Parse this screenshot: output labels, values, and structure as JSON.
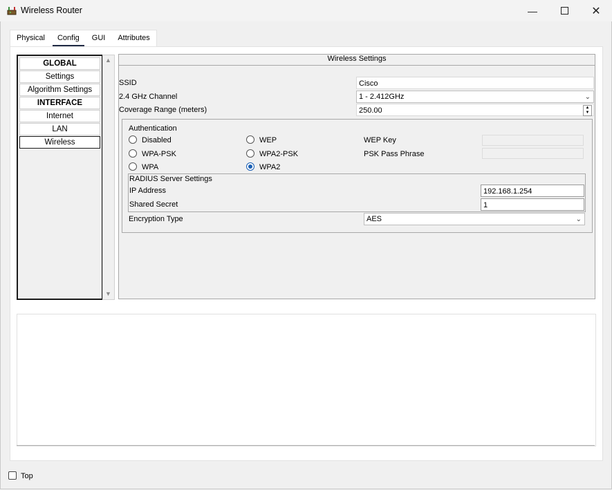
{
  "window": {
    "title": "Wireless Router",
    "icon": "router-icon",
    "controls": [
      "minimize-icon",
      "maximize-icon",
      "close-icon"
    ]
  },
  "tabs": [
    {
      "label": "Physical"
    },
    {
      "label": "Config",
      "active": true
    },
    {
      "label": "GUI"
    },
    {
      "label": "Attributes"
    }
  ],
  "sidebar": {
    "items": [
      {
        "label": "GLOBAL",
        "bold": true
      },
      {
        "label": "Settings"
      },
      {
        "label": "Algorithm Settings"
      },
      {
        "label": "INTERFACE",
        "bold": true
      },
      {
        "label": "Internet"
      },
      {
        "label": "LAN"
      },
      {
        "label": "Wireless",
        "selected": true
      }
    ]
  },
  "wireless": {
    "header": "Wireless Settings",
    "ssid_label": "SSID",
    "ssid_value": "Cisco",
    "channel_label": "2.4 GHz Channel",
    "channel_value": "1 - 2.412GHz",
    "coverage_label": "Coverage Range (meters)",
    "coverage_value": "250.00",
    "auth": {
      "title": "Authentication",
      "options": {
        "disabled": "Disabled",
        "wep": "WEP",
        "wpa_psk": "WPA-PSK",
        "wpa2_psk": "WPA2-PSK",
        "wpa": "WPA",
        "wpa2": "WPA2"
      },
      "selected": "WPA2",
      "wep_key_label": "WEP Key",
      "psk_label": "PSK Pass Phrase"
    },
    "radius": {
      "title": "RADIUS Server Settings",
      "ip_label": "IP Address",
      "ip_value": "192.168.1.254",
      "secret_label": "Shared Secret",
      "secret_value": "1"
    },
    "encryption_label": "Encryption Type",
    "encryption_value": "AES"
  },
  "footer": {
    "top_label": "Top",
    "top_checked": false
  },
  "colors": {
    "accent": "#1a5fb4",
    "tab_underline": "#1f2a44"
  }
}
